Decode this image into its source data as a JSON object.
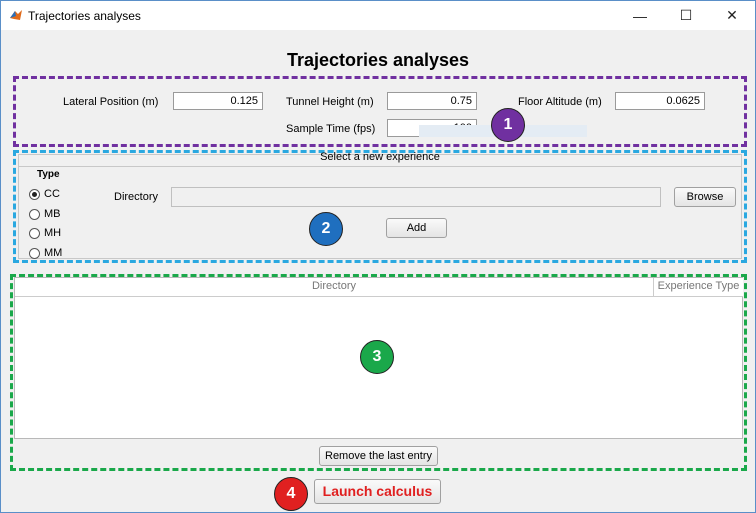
{
  "window": {
    "title": "Trajectories analyses",
    "minimize": "—",
    "maximize": "☐",
    "close": "✕"
  },
  "page_title": "Trajectories analyses",
  "params": {
    "lateral_label": "Lateral Position (m)",
    "lateral_value": "0.125",
    "tunnel_label": "Tunnel Height (m)",
    "tunnel_value": "0.75",
    "floor_label": "Floor Altitude (m)",
    "floor_value": "0.0625",
    "sample_label": "Sample Time (fps)",
    "sample_value": "100"
  },
  "experience": {
    "panel_title": "Select a new experience",
    "type_label": "Type",
    "types": [
      "CC",
      "MB",
      "MH",
      "MM"
    ],
    "selected_type": "CC",
    "directory_label": "Directory",
    "directory_value": "",
    "browse_label": "Browse",
    "add_label": "Add"
  },
  "table": {
    "col_directory": "Directory",
    "col_type": "Experience Type",
    "rows": []
  },
  "remove_label": "Remove the last entry",
  "launch_label": "Launch calculus",
  "markers": {
    "m1": "1",
    "m2": "2",
    "m3": "3",
    "m4": "4"
  },
  "colors": {
    "purple": "#7030a0",
    "blue": "#1f6fbf",
    "cyan": "#2aa8e0",
    "green": "#1aa84a",
    "red": "#e02020"
  }
}
